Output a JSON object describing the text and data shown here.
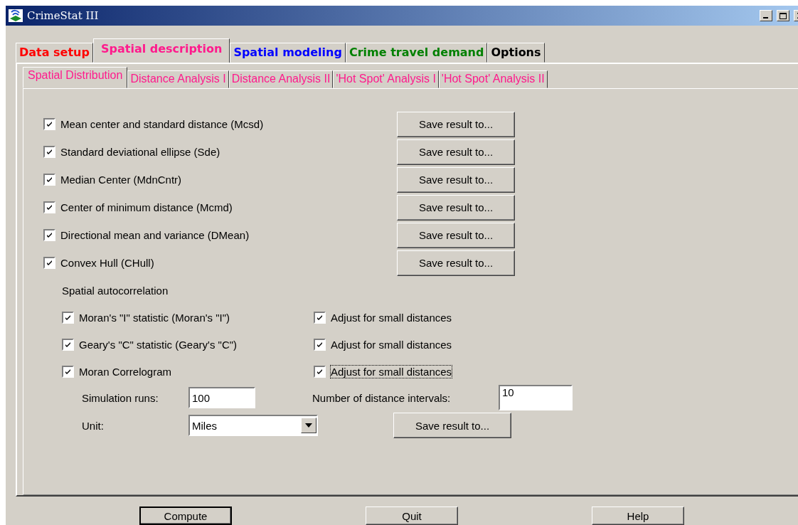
{
  "window": {
    "title": "CrimeStat III"
  },
  "tabs": [
    {
      "label": "Data setup",
      "selected": false,
      "color": "#ff0000"
    },
    {
      "label": "Spatial description",
      "selected": true,
      "color": "#ff1a8c"
    },
    {
      "label": "Spatial modeling",
      "selected": false,
      "color": "#0000ff"
    },
    {
      "label": "Crime travel demand",
      "selected": false,
      "color": "#008000"
    },
    {
      "label": "Options",
      "selected": false,
      "color": "#000000"
    }
  ],
  "subtabs": [
    {
      "label": "Spatial Distribution",
      "selected": true
    },
    {
      "label": "Distance Analysis I",
      "selected": false
    },
    {
      "label": "Distance Analysis II",
      "selected": false
    },
    {
      "label": "'Hot Spot' Analysis I",
      "selected": false
    },
    {
      "label": "'Hot Spot' Analysis II",
      "selected": false
    }
  ],
  "statistics": [
    {
      "label": "Mean center and standard distance (Mcsd)",
      "checked": true,
      "button": "Save result to..."
    },
    {
      "label": "Standard deviational ellipse (Sde)",
      "checked": true,
      "button": "Save result to..."
    },
    {
      "label": "Median Center (MdnCntr)",
      "checked": true,
      "button": "Save result to..."
    },
    {
      "label": "Center of minimum distance (Mcmd)",
      "checked": true,
      "button": "Save result to..."
    },
    {
      "label": "Directional mean and variance (DMean)",
      "checked": true,
      "button": "Save result to..."
    },
    {
      "label": "Convex Hull (CHull)",
      "checked": true,
      "button": "Save result to..."
    }
  ],
  "autocorrelation": {
    "heading": "Spatial autocorrelation",
    "items": [
      {
        "label": "Moran's \"I\" statistic (Moran's \"I\")",
        "checked": true,
        "adjust": {
          "label": "Adjust for small distances",
          "checked": true,
          "focused": false
        }
      },
      {
        "label": "Geary's \"C\" statistic (Geary's \"C\")",
        "checked": true,
        "adjust": {
          "label": "Adjust for small distances",
          "checked": true,
          "focused": false
        }
      },
      {
        "label": "Moran Correlogram",
        "checked": true,
        "adjust": {
          "label": "Adjust for small distances",
          "checked": true,
          "focused": true
        }
      }
    ],
    "simulation_runs": {
      "label": "Simulation runs:",
      "value": "100"
    },
    "unit": {
      "label": "Unit:",
      "value": "Miles"
    },
    "intervals": {
      "label": "Number of distance intervals:",
      "value": "10"
    },
    "button": "Save result to..."
  },
  "footer_buttons": [
    {
      "label": "Compute",
      "default": true
    },
    {
      "label": "Quit",
      "default": false
    },
    {
      "label": "Help",
      "default": false
    }
  ]
}
